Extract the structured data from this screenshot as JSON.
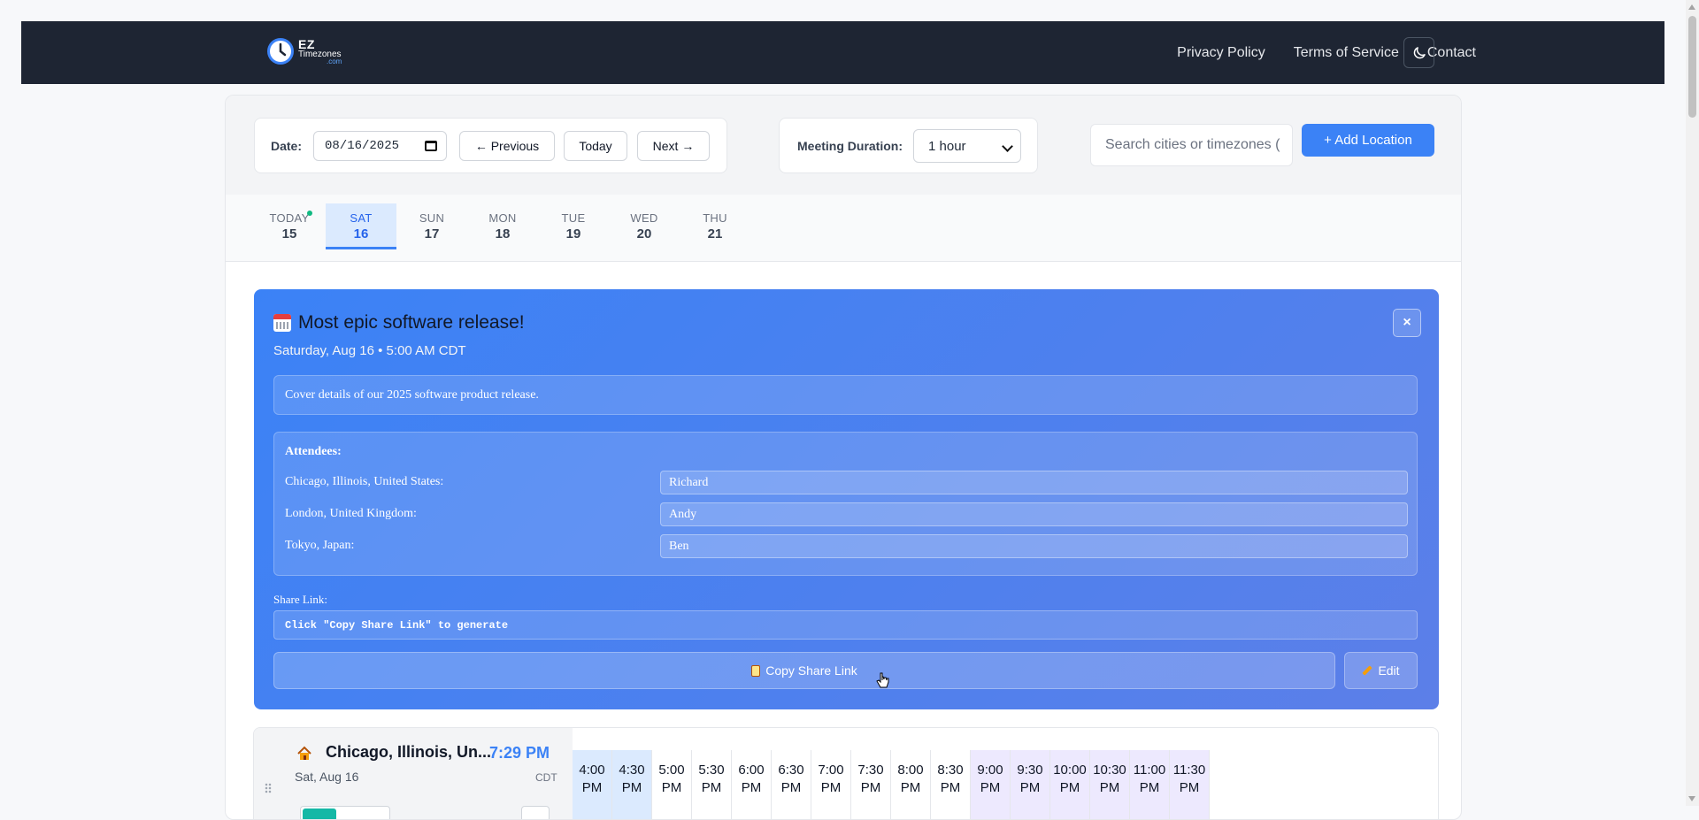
{
  "brand": {
    "line1": "EZ",
    "line2": "Timezones",
    "line3": ".com"
  },
  "nav": {
    "privacy": "Privacy Policy",
    "terms": "Terms of Service",
    "contact": "Contact"
  },
  "controls": {
    "date_label": "Date:",
    "date_value": "08/16/2025",
    "prev": "← Previous",
    "today": "Today",
    "next": "Next →",
    "duration_label": "Meeting Duration:",
    "duration_value": "1 hour",
    "search_placeholder": "Search cities or timezones (",
    "add_location": "+ Add Location"
  },
  "days": [
    {
      "name": "TODAY",
      "num": "15"
    },
    {
      "name": "SAT",
      "num": "16"
    },
    {
      "name": "SUN",
      "num": "17"
    },
    {
      "name": "MON",
      "num": "18"
    },
    {
      "name": "TUE",
      "num": "19"
    },
    {
      "name": "WED",
      "num": "20"
    },
    {
      "name": "THU",
      "num": "21"
    }
  ],
  "event": {
    "title": "Most epic software release!",
    "subtitle": "Saturday, Aug 16 • 5:00 AM CDT",
    "close": "×",
    "description": "Cover details of our 2025 software product release.",
    "attendees_label": "Attendees:",
    "attendees": [
      {
        "location": "Chicago, Illinois, United States:",
        "name": "Richard"
      },
      {
        "location": "London, United Kingdom:",
        "name": "Andy"
      },
      {
        "location": "Tokyo, Japan:",
        "name": "Ben"
      }
    ],
    "share_label": "Share Link:",
    "share_value": "Click \"Copy Share Link\" to generate",
    "copy_button": "Copy Share Link",
    "edit_button": "Edit"
  },
  "location": {
    "name": "Chicago, Illinois, Un...",
    "time": "7:29 PM",
    "date": "Sat, Aug 16",
    "tz": "CDT",
    "slots": [
      {
        "t": "4:00",
        "p": "PM"
      },
      {
        "t": "4:30",
        "p": "PM"
      },
      {
        "t": "5:00",
        "p": "PM"
      },
      {
        "t": "5:30",
        "p": "PM"
      },
      {
        "t": "6:00",
        "p": "PM"
      },
      {
        "t": "6:30",
        "p": "PM"
      },
      {
        "t": "7:00",
        "p": "PM"
      },
      {
        "t": "7:30",
        "p": "PM"
      },
      {
        "t": "8:00",
        "p": "PM"
      },
      {
        "t": "8:30",
        "p": "PM"
      },
      {
        "t": "9:00",
        "p": "PM"
      },
      {
        "t": "9:30",
        "p": "PM"
      },
      {
        "t": "10:00",
        "p": "PM"
      },
      {
        "t": "10:30",
        "p": "PM"
      },
      {
        "t": "11:00",
        "p": "PM"
      },
      {
        "t": "11:30",
        "p": "PM"
      }
    ]
  },
  "colors": {
    "accent": "#3b82f6",
    "header": "#1e2533",
    "today_dot": "#10b981"
  }
}
